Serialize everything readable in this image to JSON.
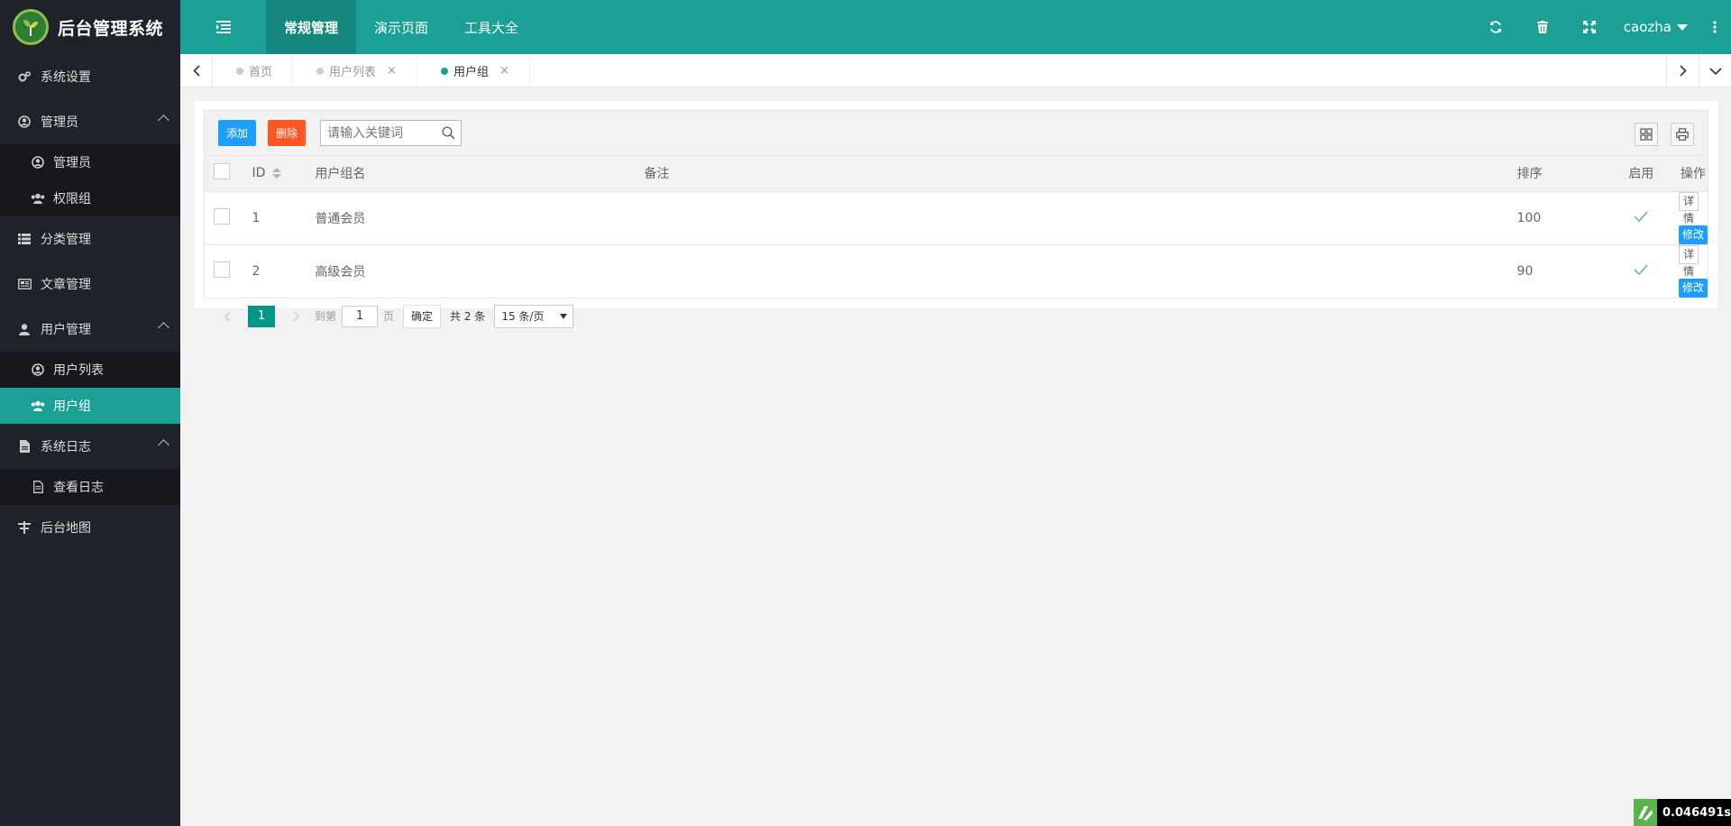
{
  "app": {
    "title": "后台管理系统"
  },
  "nav": {
    "items": [
      {
        "label": "常规管理"
      },
      {
        "label": "演示页面"
      },
      {
        "label": "工具大全"
      }
    ],
    "user": "caozha"
  },
  "sidebar": {
    "items": [
      {
        "label": "系统设置",
        "icon": "gears-icon"
      },
      {
        "label": "管理员",
        "icon": "user-circle-icon",
        "expanded": true
      },
      {
        "label": "分类管理",
        "icon": "list-icon"
      },
      {
        "label": "文章管理",
        "icon": "newspaper-icon"
      },
      {
        "label": "用户管理",
        "icon": "user-icon",
        "expanded": true
      },
      {
        "label": "系统日志",
        "icon": "file-icon",
        "expanded": true
      },
      {
        "label": "后台地图",
        "icon": "sitemap-icon"
      }
    ],
    "admin_sub": [
      {
        "label": "管理员"
      },
      {
        "label": "权限组"
      }
    ],
    "user_sub": [
      {
        "label": "用户列表"
      },
      {
        "label": "用户组",
        "active": true
      }
    ],
    "log_sub": [
      {
        "label": "查看日志"
      }
    ]
  },
  "tabs": [
    {
      "label": "首页"
    },
    {
      "label": "用户列表",
      "close": "×"
    },
    {
      "label": "用户组",
      "close": "×",
      "active": true
    }
  ],
  "toolbar": {
    "add_label": "添加",
    "delete_label": "删除",
    "search_placeholder": "请输入关键词"
  },
  "table": {
    "headers": {
      "id": "ID",
      "name": "用户组名",
      "remark": "备注",
      "sort": "排序",
      "enabled": "启用",
      "ops": "操作"
    },
    "rows": [
      {
        "id": "1",
        "name": "普通会员",
        "remark": "",
        "sort": "100",
        "detail": "详情",
        "edit": "修改"
      },
      {
        "id": "2",
        "name": "高级会员",
        "remark": "",
        "sort": "90",
        "detail": "详情",
        "edit": "修改"
      }
    ]
  },
  "pager": {
    "current": "1",
    "goto_label": "到第",
    "page_value": "1",
    "page_unit": "页",
    "confirm": "确定",
    "total": "共 2 条",
    "per_page": "15 条/页"
  },
  "perf": {
    "time": "0.046491s"
  },
  "colors": {
    "accent": "#1aa094",
    "sidebar": "#20222a",
    "blue": "#1e9fff",
    "orange": "#ff5722"
  }
}
